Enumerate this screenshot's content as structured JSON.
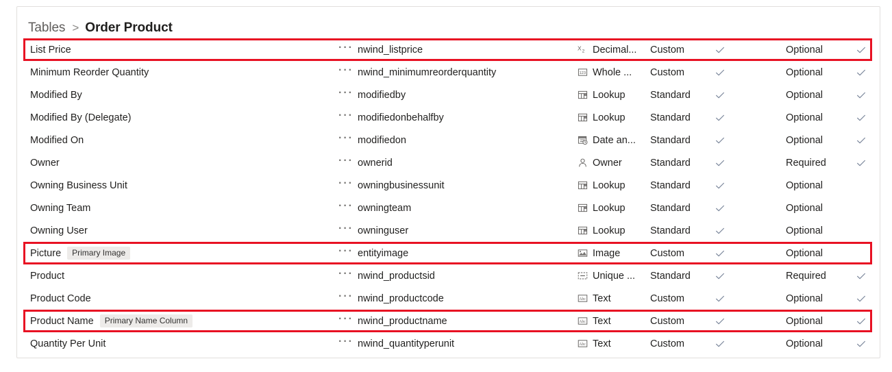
{
  "breadcrumb": {
    "root": "Tables",
    "separator": ">",
    "current": "Order Product"
  },
  "colors": {
    "highlight": "#e81123",
    "badge_bg": "#edebe9",
    "check": "#7a869a",
    "panel_border": "#e1dfdd",
    "text": "#201f1e",
    "muted": "#605e5c"
  },
  "grid": {
    "ellipsis_label": "···",
    "rows": [
      {
        "display_name": "List Price",
        "badge": null,
        "logical_name": "nwind_listprice",
        "type": "Decimal...",
        "type_icon": "decimal-icon",
        "origin": "Custom",
        "customizable": true,
        "requirement": "Optional",
        "searchable": true,
        "highlighted": true
      },
      {
        "display_name": "Minimum Reorder Quantity",
        "badge": null,
        "logical_name": "nwind_minimumreorderquantity",
        "type": "Whole ...",
        "type_icon": "whole-number-icon",
        "origin": "Custom",
        "customizable": true,
        "requirement": "Optional",
        "searchable": true,
        "highlighted": false
      },
      {
        "display_name": "Modified By",
        "badge": null,
        "logical_name": "modifiedby",
        "type": "Lookup",
        "type_icon": "lookup-icon",
        "origin": "Standard",
        "customizable": true,
        "requirement": "Optional",
        "searchable": true,
        "highlighted": false
      },
      {
        "display_name": "Modified By (Delegate)",
        "badge": null,
        "logical_name": "modifiedonbehalfby",
        "type": "Lookup",
        "type_icon": "lookup-icon",
        "origin": "Standard",
        "customizable": true,
        "requirement": "Optional",
        "searchable": true,
        "highlighted": false
      },
      {
        "display_name": "Modified On",
        "badge": null,
        "logical_name": "modifiedon",
        "type": "Date an...",
        "type_icon": "date-time-icon",
        "origin": "Standard",
        "customizable": true,
        "requirement": "Optional",
        "searchable": true,
        "highlighted": false
      },
      {
        "display_name": "Owner",
        "badge": null,
        "logical_name": "ownerid",
        "type": "Owner",
        "type_icon": "owner-person-icon",
        "origin": "Standard",
        "customizable": true,
        "requirement": "Required",
        "searchable": true,
        "highlighted": false
      },
      {
        "display_name": "Owning Business Unit",
        "badge": null,
        "logical_name": "owningbusinessunit",
        "type": "Lookup",
        "type_icon": "lookup-icon",
        "origin": "Standard",
        "customizable": true,
        "requirement": "Optional",
        "searchable": false,
        "highlighted": false
      },
      {
        "display_name": "Owning Team",
        "badge": null,
        "logical_name": "owningteam",
        "type": "Lookup",
        "type_icon": "lookup-icon",
        "origin": "Standard",
        "customizable": true,
        "requirement": "Optional",
        "searchable": false,
        "highlighted": false
      },
      {
        "display_name": "Owning User",
        "badge": null,
        "logical_name": "owninguser",
        "type": "Lookup",
        "type_icon": "lookup-icon",
        "origin": "Standard",
        "customizable": true,
        "requirement": "Optional",
        "searchable": false,
        "highlighted": false
      },
      {
        "display_name": "Picture",
        "badge": "Primary Image",
        "logical_name": "entityimage",
        "type": "Image",
        "type_icon": "image-icon",
        "origin": "Custom",
        "customizable": true,
        "requirement": "Optional",
        "searchable": false,
        "highlighted": true
      },
      {
        "display_name": "Product",
        "badge": null,
        "logical_name": "nwind_productsid",
        "type": "Unique ...",
        "type_icon": "unique-identifier-icon",
        "origin": "Standard",
        "customizable": true,
        "requirement": "Required",
        "searchable": true,
        "highlighted": false
      },
      {
        "display_name": "Product Code",
        "badge": null,
        "logical_name": "nwind_productcode",
        "type": "Text",
        "type_icon": "text-icon",
        "origin": "Custom",
        "customizable": true,
        "requirement": "Optional",
        "searchable": true,
        "highlighted": false
      },
      {
        "display_name": "Product Name",
        "badge": "Primary Name Column",
        "logical_name": "nwind_productname",
        "type": "Text",
        "type_icon": "text-icon",
        "origin": "Custom",
        "customizable": true,
        "requirement": "Optional",
        "searchable": true,
        "highlighted": true
      },
      {
        "display_name": "Quantity Per Unit",
        "badge": null,
        "logical_name": "nwind_quantityperunit",
        "type": "Text",
        "type_icon": "text-icon",
        "origin": "Custom",
        "customizable": true,
        "requirement": "Optional",
        "searchable": true,
        "highlighted": false
      }
    ]
  }
}
